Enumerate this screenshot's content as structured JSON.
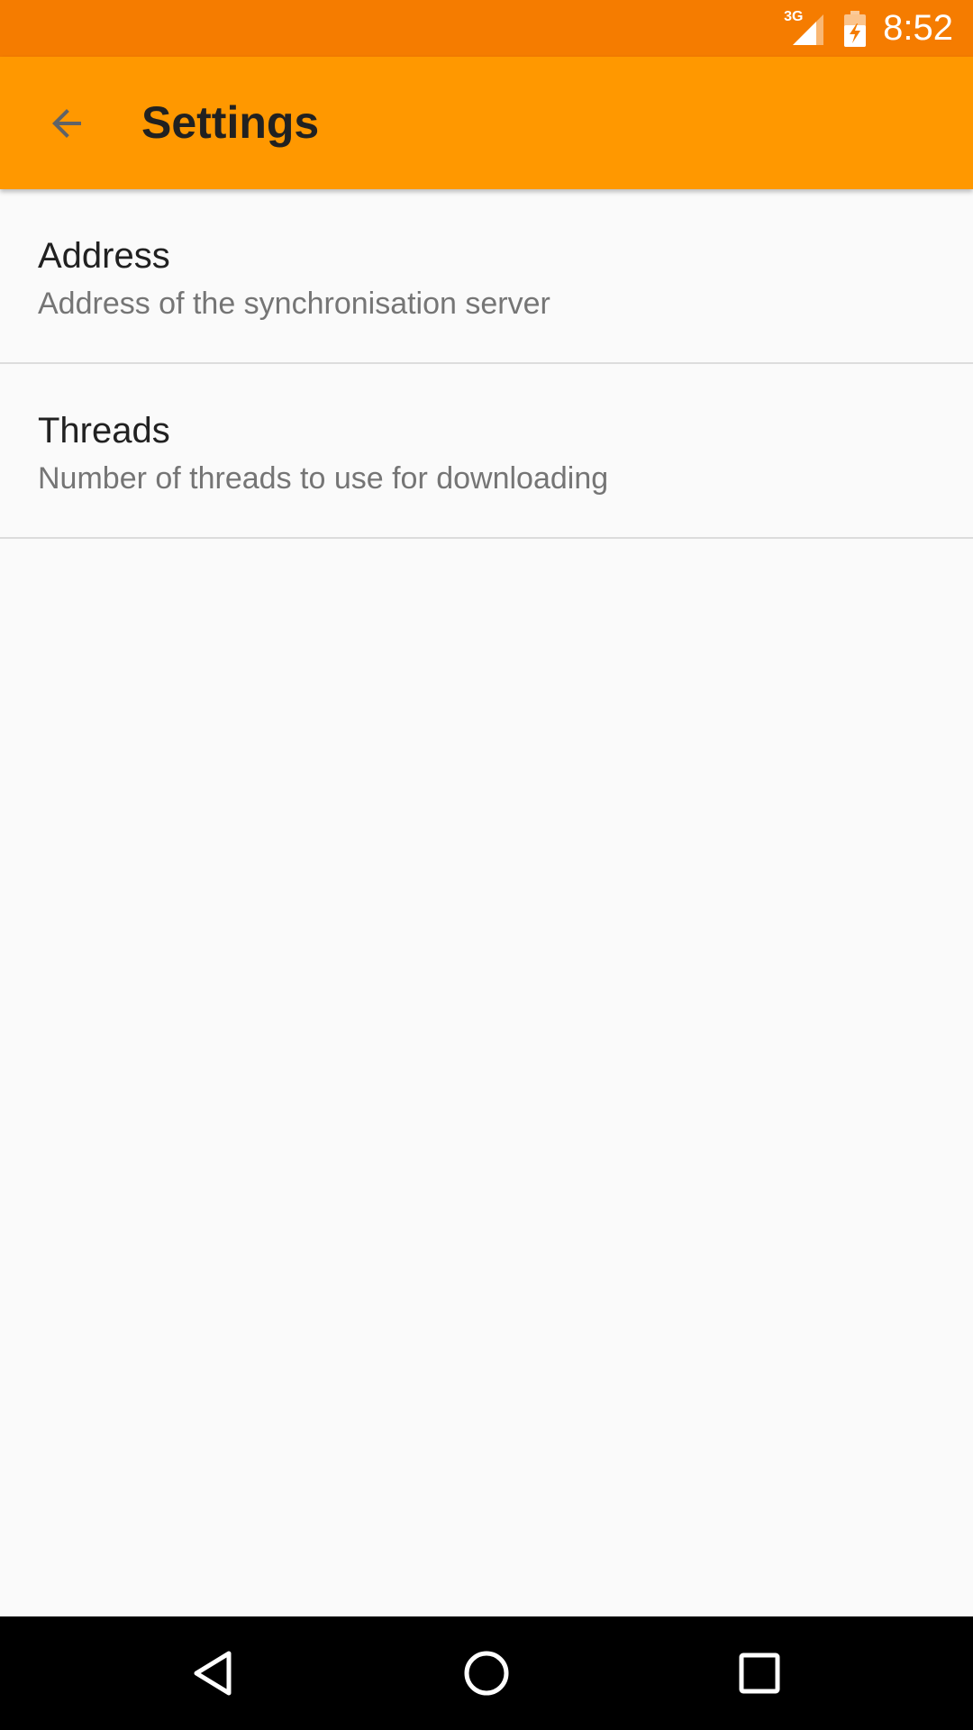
{
  "status_bar": {
    "network_type": "3G",
    "time": "8:52",
    "icons": [
      "signal-icon",
      "battery-charging-icon"
    ]
  },
  "app_bar": {
    "back_icon": "arrow-back-icon",
    "title": "Settings",
    "background_color": "#ff9800",
    "status_bar_color": "#f57c00"
  },
  "preferences": [
    {
      "title": "Address",
      "summary": "Address of the synchronisation server"
    },
    {
      "title": "Threads",
      "summary": "Number of threads to use for downloading"
    }
  ],
  "navigation_bar": {
    "buttons": [
      "back-triangle-icon",
      "home-circle-icon",
      "recents-square-icon"
    ]
  }
}
